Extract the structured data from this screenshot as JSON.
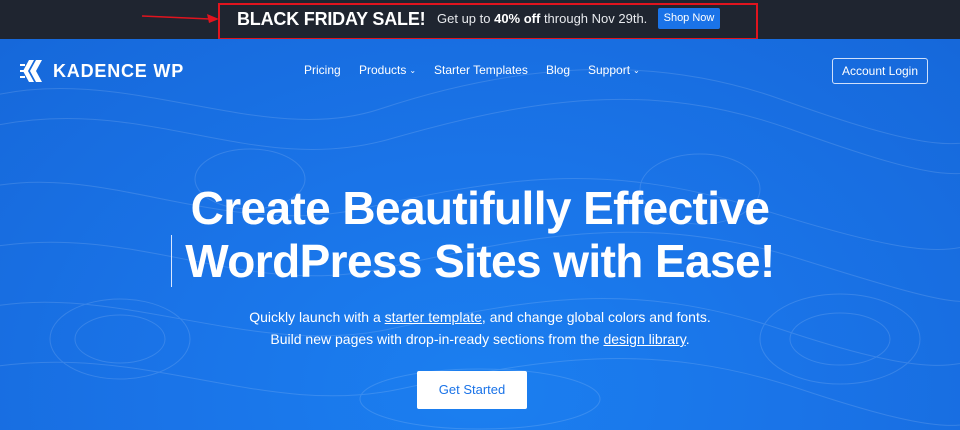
{
  "promo": {
    "title": "BLACK FRIDAY SALE!",
    "text_prefix": "Get up to ",
    "text_bold": "40% off",
    "text_suffix": " through Nov 29th.",
    "button": "Shop Now"
  },
  "header": {
    "logo_text": "KADENCE WP",
    "nav": [
      {
        "label": "Pricing"
      },
      {
        "label": "Products",
        "dropdown": true
      },
      {
        "label": "Starter Templates"
      },
      {
        "label": "Blog"
      },
      {
        "label": "Support",
        "dropdown": true
      }
    ],
    "chevron": "⌄",
    "account_login": "Account Login"
  },
  "hero": {
    "headline_line1": "Create Beautifully Effective",
    "headline_line2": "WordPress Sites with Ease!",
    "sub1_before": "Quickly launch with a ",
    "sub1_link": "starter template",
    "sub1_after": ", and change global colors and fonts.",
    "sub2_before": "Build new pages with drop-in-ready sections from the ",
    "sub2_link": "design library",
    "sub2_after": ".",
    "cta": "Get Started"
  },
  "colors": {
    "brand_blue": "#1a73e8",
    "promo_bg": "#1f2530",
    "highlight_border": "#e0141e"
  }
}
